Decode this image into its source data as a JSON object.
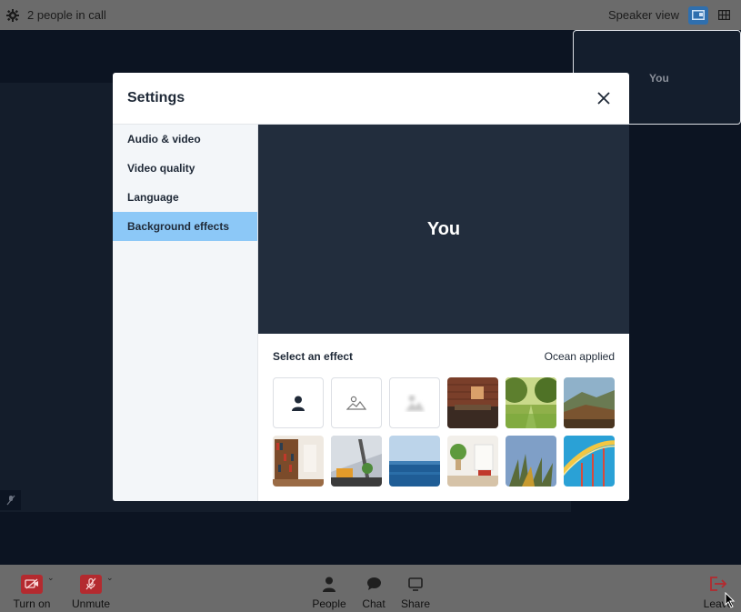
{
  "topbar": {
    "people_count": "2 people in call",
    "view_label": "Speaker view"
  },
  "stage": {
    "self_tile_label": "You"
  },
  "toolbar": {
    "camera_label": "Turn on",
    "mic_label": "Unmute",
    "people_label": "People",
    "chat_label": "Chat",
    "share_label": "Share",
    "leave_label": "Leave"
  },
  "settings": {
    "title": "Settings",
    "nav": [
      "Audio & video",
      "Video quality",
      "Language",
      "Background effects"
    ],
    "active_nav": "Background effects",
    "preview_label": "You",
    "effects_title": "Select an effect",
    "effects_status": "Ocean applied",
    "effects": [
      {
        "name": "none",
        "icon": "person-icon"
      },
      {
        "name": "blur-light",
        "icon": "landscape-icon"
      },
      {
        "name": "blur-strong",
        "icon": "blurred-icon"
      },
      {
        "name": "brick-room"
      },
      {
        "name": "forest-path"
      },
      {
        "name": "mountain"
      },
      {
        "name": "bookshelf"
      },
      {
        "name": "modern-interior"
      },
      {
        "name": "ocean"
      },
      {
        "name": "plant-room"
      },
      {
        "name": "palm-sky"
      },
      {
        "name": "rollercoaster"
      }
    ]
  },
  "colors": {
    "active_nav": "#8cc8f7",
    "preview_bg": "#222d3d",
    "muted_red": "#b42a2f",
    "leave_red": "#b42a2f"
  }
}
